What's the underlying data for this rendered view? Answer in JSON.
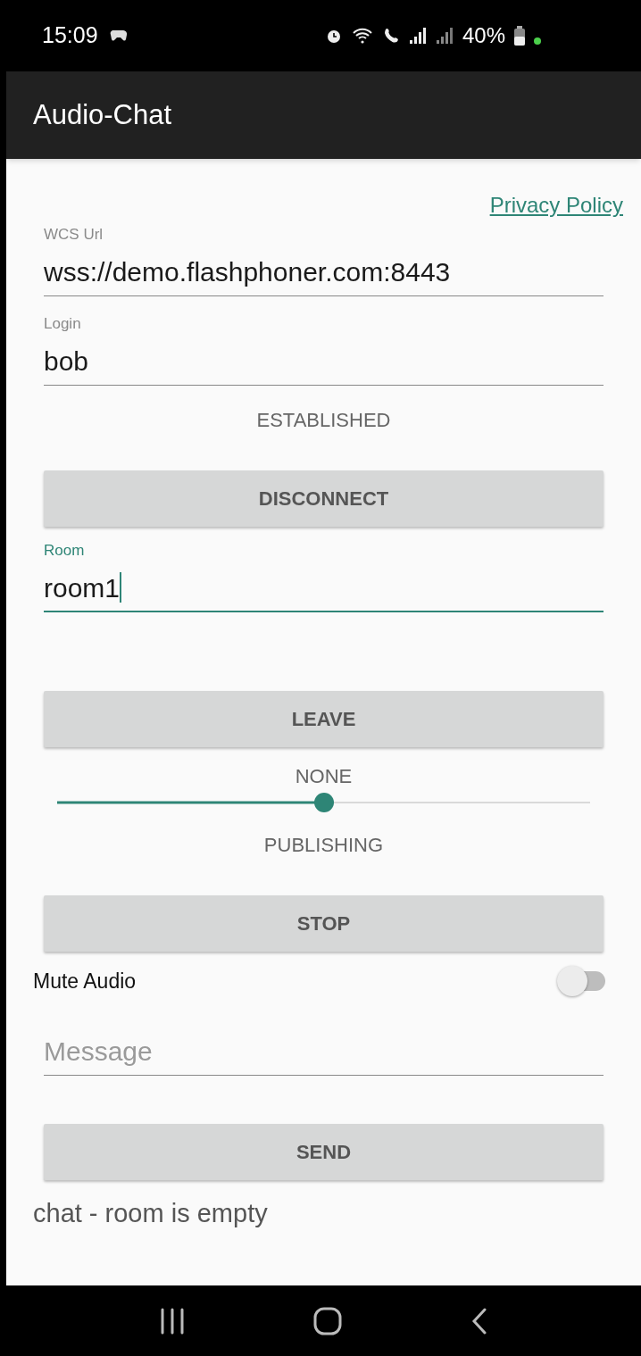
{
  "status_bar": {
    "time": "15:09",
    "battery": "40%"
  },
  "app_bar": {
    "title": "Audio-Chat"
  },
  "privacy_link": "Privacy Policy",
  "connection_fields": [
    {
      "label": "WCS Url",
      "value": "wss://demo.flashphoner.com:8443",
      "focused": false
    },
    {
      "label": "Login",
      "value": "bob",
      "focused": false
    }
  ],
  "connection_status": "ESTABLISHED",
  "connect_button": "DISCONNECT",
  "room_field": {
    "label": "Room",
    "value": "room1",
    "focused": true
  },
  "room_button": "LEAVE",
  "slider": {
    "label_top": "NONE",
    "level": 0.5,
    "label_bottom": "PUBLISHING"
  },
  "stream_button": "STOP",
  "mute_switch": {
    "label": "Mute Audio",
    "on": false
  },
  "message_field": {
    "placeholder": "Message",
    "focused": false
  },
  "send_button": "SEND",
  "chat_status": "chat - room is empty"
}
